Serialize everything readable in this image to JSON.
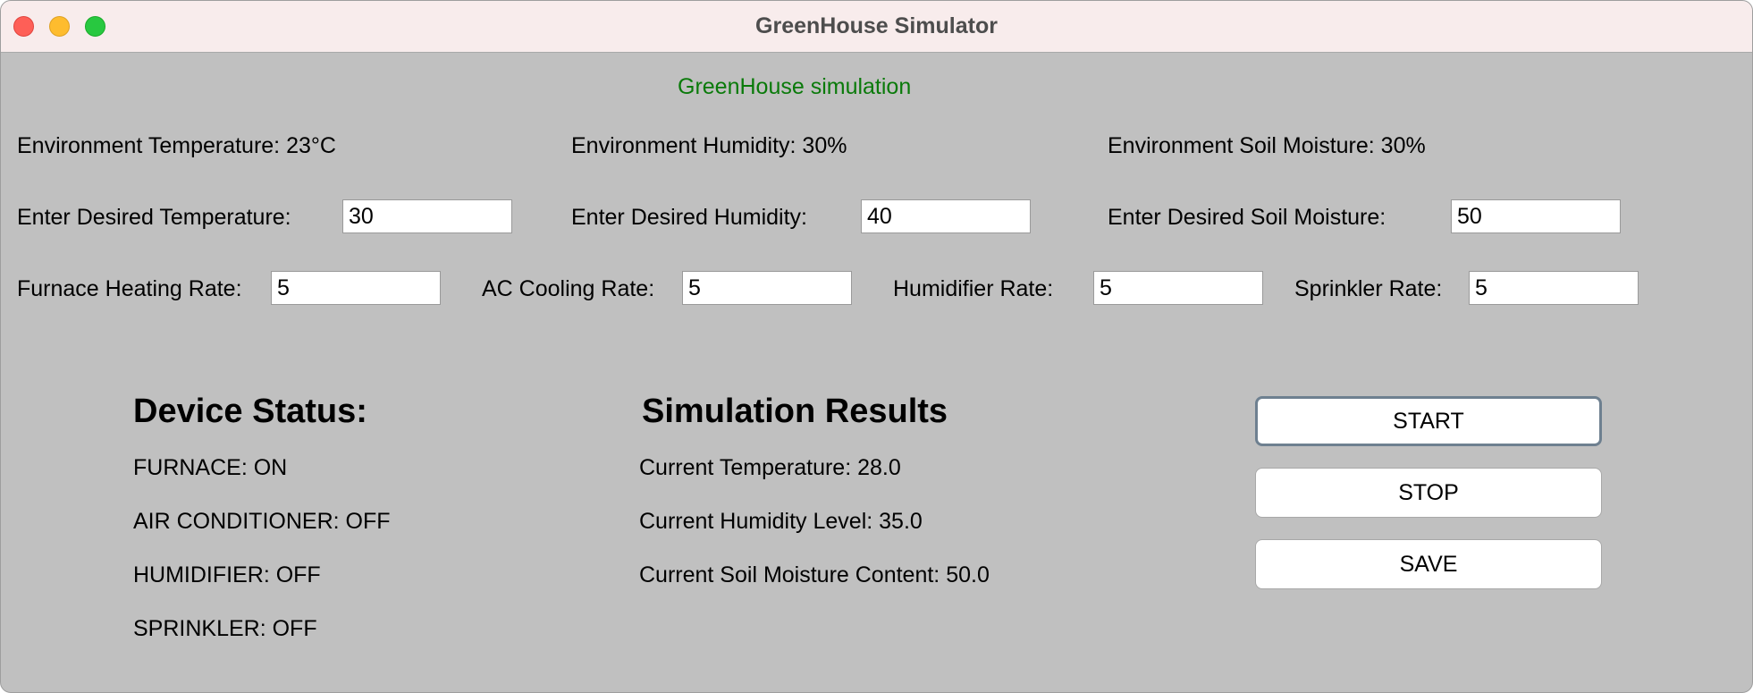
{
  "window": {
    "title": "GreenHouse Simulator"
  },
  "header": {
    "simulation_title": "GreenHouse simulation"
  },
  "environment": {
    "temperature": "Environment Temperature: 23°C",
    "humidity": "Environment Humidity: 30%",
    "soil_moisture": "Environment Soil Moisture: 30%"
  },
  "desired": {
    "temperature_label": "Enter Desired Temperature:",
    "temperature_value": "30",
    "humidity_label": "Enter Desired Humidity:",
    "humidity_value": "40",
    "soil_label": "Enter Desired Soil Moisture:",
    "soil_value": "50"
  },
  "rates": {
    "furnace_label": "Furnace Heating Rate:",
    "furnace_value": "5",
    "ac_label": "AC Cooling Rate:",
    "ac_value": "5",
    "humidifier_label": "Humidifier Rate:",
    "humidifier_value": "5",
    "sprinkler_label": "Sprinkler Rate:",
    "sprinkler_value": "5"
  },
  "device_status": {
    "heading": "Device Status:",
    "furnace": "FURNACE: ON",
    "air_conditioner": "AIR CONDITIONER: OFF",
    "humidifier": "HUMIDIFIER: OFF",
    "sprinkler": "SPRINKLER: OFF"
  },
  "results": {
    "heading": "Simulation Results",
    "temperature": "Current Temperature: 28.0",
    "humidity": "Current Humidity Level: 35.0",
    "soil": "Current Soil Moisture Content: 50.0"
  },
  "buttons": {
    "start": "START",
    "stop": "STOP",
    "save": "SAVE"
  },
  "colors": {
    "title_green": "#0a7a0a",
    "panel_bg": "#c0c0c0",
    "titlebar_bg": "#f8ecec"
  }
}
